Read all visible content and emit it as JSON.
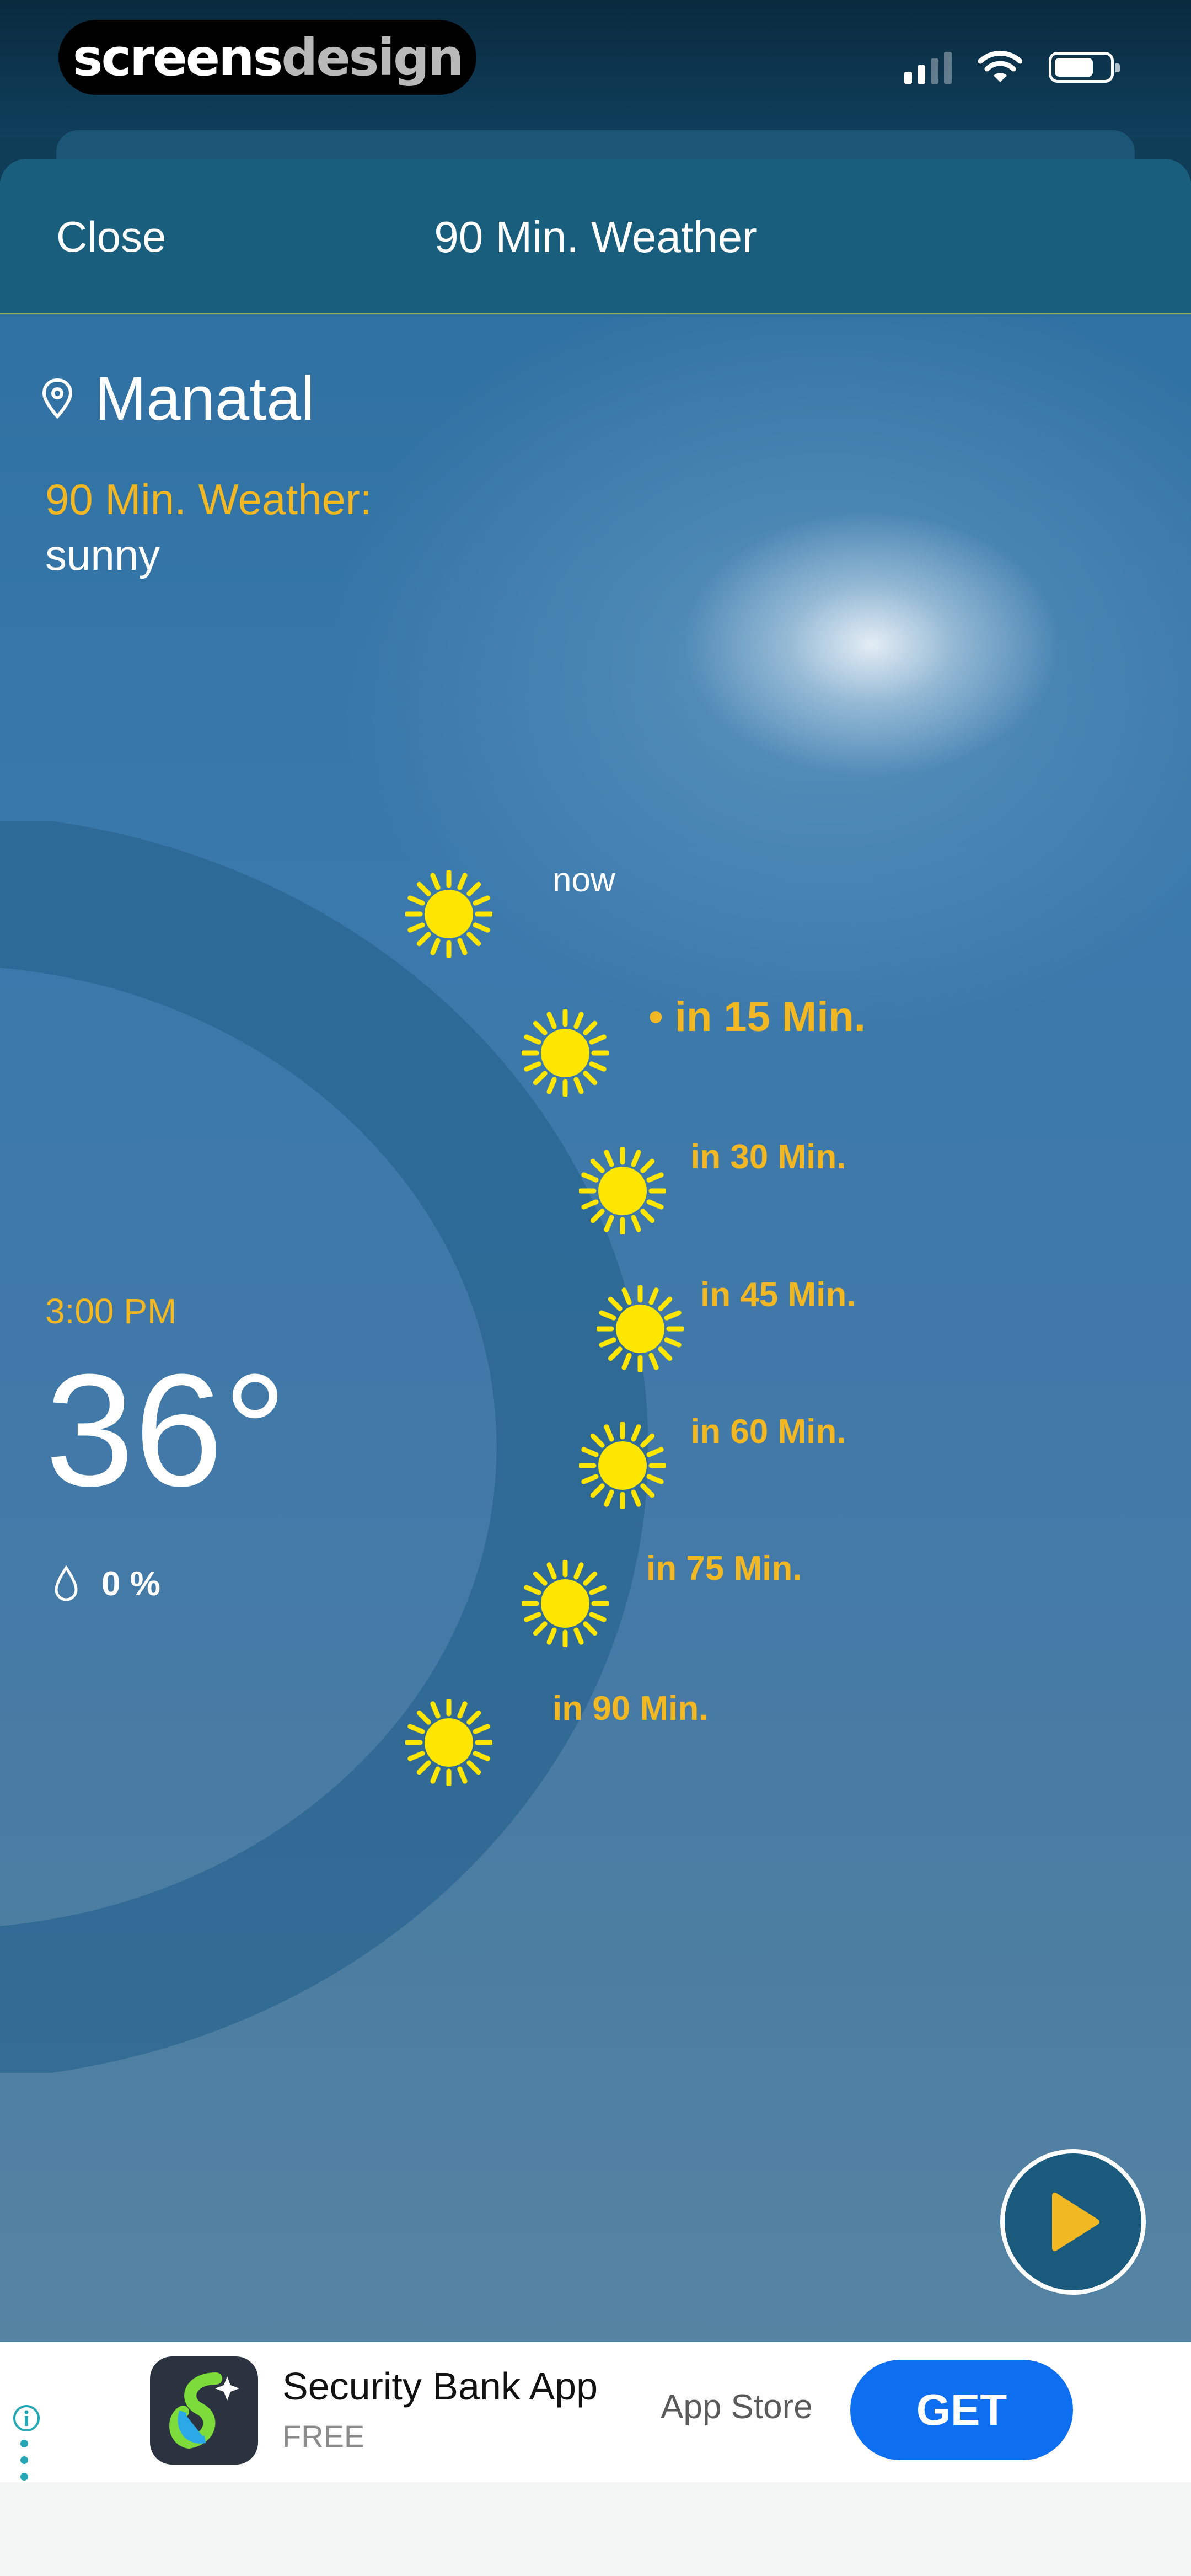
{
  "status_bar": {
    "brand_part1": "screens",
    "brand_part2": "design"
  },
  "nav": {
    "close_label": "Close",
    "title": "90 Min. Weather"
  },
  "location": {
    "name": "Manatal"
  },
  "summary": {
    "label": "90 Min. Weather:",
    "condition": "sunny"
  },
  "current": {
    "time": "3:00 PM",
    "temperature": "36°",
    "precipitation": "0 %"
  },
  "timeline": {
    "steps": [
      {
        "label": "now",
        "icon": "sun-icon"
      },
      {
        "label": "• in 15 Min.",
        "icon": "sun-icon",
        "active": true
      },
      {
        "label": "in 30 Min.",
        "icon": "sun-icon"
      },
      {
        "label": "in 45 Min.",
        "icon": "sun-icon"
      },
      {
        "label": "in 60 Min.",
        "icon": "sun-icon"
      },
      {
        "label": "in 75 Min.",
        "icon": "sun-icon"
      },
      {
        "label": "in 90 Min.",
        "icon": "sun-icon"
      }
    ]
  },
  "ad": {
    "title": "Security Bank App",
    "price": "FREE",
    "store": "App Store",
    "cta": "GET"
  },
  "colors": {
    "accent": "#f2b824",
    "sun": "#ffe600",
    "nav_bg": "#1a5e7e",
    "cta": "#0d6ef0"
  }
}
